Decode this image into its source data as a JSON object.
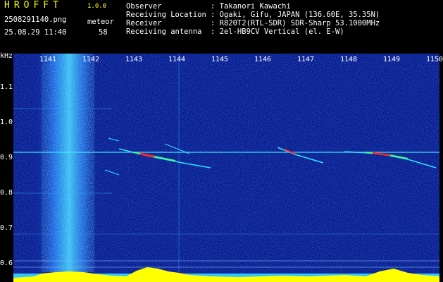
{
  "header": {
    "app_title": "HROFFT",
    "version": "1.0.0",
    "filename": "2508291140.png",
    "category": "meteor",
    "timestamp": "25.08.29 11:40",
    "count": "58",
    "info": [
      {
        "label": "Observer",
        "value": ": Takanori Kawachi"
      },
      {
        "label": "Receiving Location",
        "value": ": Ogaki, Gifu, JAPAN (136.60E, 35.35N)"
      },
      {
        "label": "Receiver",
        "value": ": R820T2(RTL-SDR) SDR-Sharp 53.1000MHz"
      },
      {
        "label": "Receiving antenna",
        "value": ": 2el-HB9CV Vertical (el. E-W)"
      }
    ]
  },
  "spectrogram": {
    "y_unit": "kHz",
    "y_ticks": [
      "1.1",
      "1.0",
      "0.9",
      "0.8",
      "0.7",
      "0.6"
    ],
    "x_ticks": [
      "1141",
      "1142",
      "1143",
      "1144",
      "1145",
      "1146",
      "1147",
      "1148",
      "1149",
      "1150"
    ],
    "colors": {
      "background": "#0a1a8a",
      "noise": "#2a6cf0",
      "signal": "#ff2020",
      "level_bar": "#ffff00"
    }
  }
}
